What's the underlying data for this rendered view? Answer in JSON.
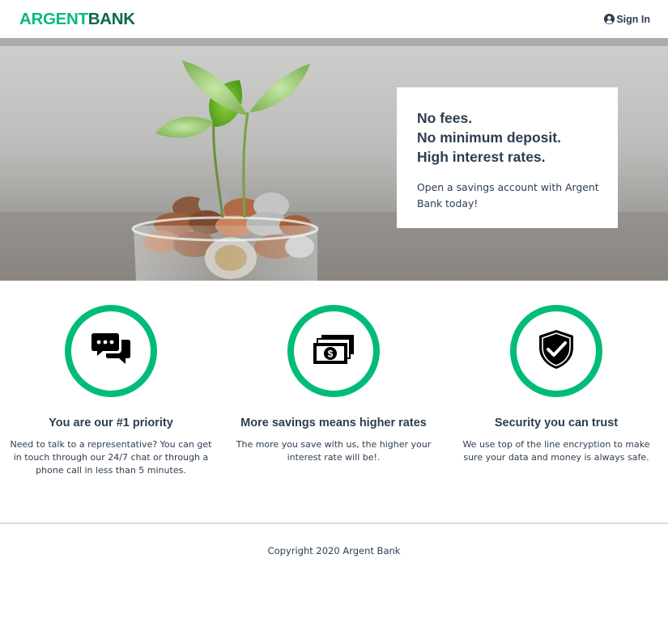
{
  "nav": {
    "logo_part1": "ARGENT",
    "logo_part2": "BANK",
    "signin_label": "Sign In",
    "signin_icon": "user-circle-icon"
  },
  "hero": {
    "subtitles": [
      "No fees.",
      "No minimum deposit.",
      "High interest rates."
    ],
    "text": "Open a savings account with Argent Bank today!",
    "image": "plant-growing-from-coins-jar"
  },
  "features": [
    {
      "icon": "chat-icon",
      "title": "You are our #1 priority",
      "description": "Need to talk to a representative? You can get in touch through our 24/7 chat or through a phone call in less than 5 minutes."
    },
    {
      "icon": "money-icon",
      "title": "More savings means higher rates",
      "description": "The more you save with us, the higher your interest rate will be!."
    },
    {
      "icon": "security-icon",
      "title": "Security you can trust",
      "description": "We use top of the line encryption to make sure your data and money is always safe."
    }
  ],
  "footer": {
    "copyright": "Copyright 2020 Argent Bank"
  },
  "colors": {
    "accent": "#00bc77",
    "accent_dark": "#0b6b45",
    "text": "#2c3e50"
  }
}
